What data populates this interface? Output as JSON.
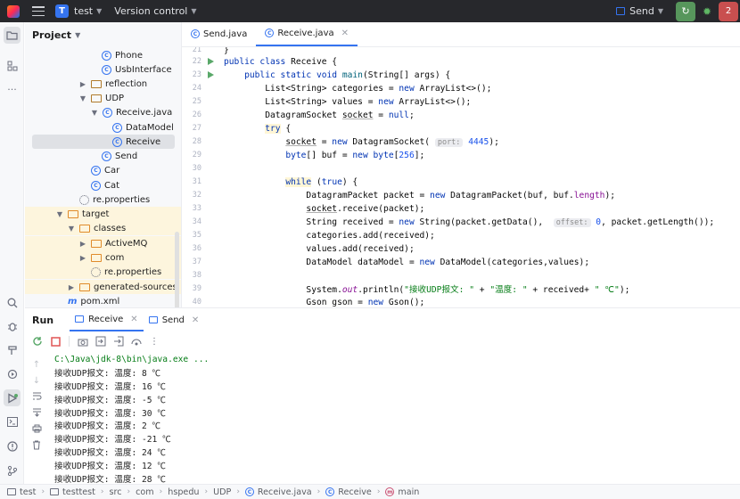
{
  "titlebar": {
    "project_initial": "T",
    "project_name": "test",
    "vcs_label": "Version control",
    "run_config": "Send",
    "notification_count": "2"
  },
  "project_panel": {
    "title": "Project",
    "items": [
      {
        "label": "Phone",
        "kind": "class"
      },
      {
        "label": "UsbInterface",
        "kind": "class"
      },
      {
        "label": "reflection",
        "kind": "package"
      },
      {
        "label": "UDP",
        "kind": "package"
      },
      {
        "label": "Receive.java",
        "kind": "class"
      },
      {
        "label": "DataModel",
        "kind": "class"
      },
      {
        "label": "Receive",
        "kind": "class"
      },
      {
        "label": "Send",
        "kind": "class"
      },
      {
        "label": "Car",
        "kind": "class"
      },
      {
        "label": "Cat",
        "kind": "class"
      },
      {
        "label": "re.properties",
        "kind": "properties"
      },
      {
        "label": "target",
        "kind": "folder"
      },
      {
        "label": "classes",
        "kind": "folder"
      },
      {
        "label": "ActiveMQ",
        "kind": "folder"
      },
      {
        "label": "com",
        "kind": "folder"
      },
      {
        "label": "re.properties",
        "kind": "properties"
      },
      {
        "label": "generated-sources",
        "kind": "folder"
      },
      {
        "label": "pom.xml",
        "kind": "maven"
      }
    ]
  },
  "editor": {
    "tabs": [
      {
        "label": "Send.java",
        "active": false
      },
      {
        "label": "Receive.java",
        "active": true
      }
    ],
    "line_numbers": [
      "21",
      "22",
      "23",
      "24",
      "25",
      "26",
      "27",
      "28",
      "29",
      "30",
      "31",
      "32",
      "33",
      "34",
      "35",
      "36",
      "37",
      "38",
      "39",
      "40"
    ],
    "hints": {
      "port": "port:",
      "offset": "offset:"
    },
    "code": {
      "l22": [
        "public class ",
        "Receive {"
      ],
      "l23": [
        "public static void ",
        "main",
        "(String[] args) {"
      ],
      "l24": [
        "List<String> categories = ",
        "new ",
        "ArrayList<>();"
      ],
      "l25": [
        "List<String> values = ",
        "new ",
        "ArrayList<>();"
      ],
      "l26": [
        "DatagramSocket ",
        "socket",
        " = ",
        "null",
        ";"
      ],
      "l27": [
        "try",
        " {"
      ],
      "l28": [
        "socket",
        " = ",
        "new ",
        "DatagramSocket(",
        "4445",
        ");"
      ],
      "l29": [
        "byte",
        "[] buf = ",
        "new ",
        "byte",
        "[",
        "256",
        "];"
      ],
      "l31": [
        "while",
        " (",
        "true",
        ") {"
      ],
      "l32": [
        "DatagramPacket packet = ",
        "new ",
        "DatagramPacket(buf, buf.",
        "length",
        ");"
      ],
      "l33": [
        "socket",
        ".receive(packet);"
      ],
      "l34": [
        "String received = ",
        "new ",
        "String(packet.getData(), ",
        "0",
        ", packet.getLength());"
      ],
      "l35": [
        "categories.add(received);"
      ],
      "l36": [
        "values.add(received);"
      ],
      "l37": [
        "DataModel dataModel = ",
        "new ",
        "DataModel(categories,values);"
      ],
      "l39": [
        "System.",
        "out",
        ".println(",
        "\"接收UDP报文: \"",
        " + ",
        "\"温度: \"",
        " + received+ ",
        "\" ℃\"",
        ");"
      ],
      "l40": [
        "Gson gson = ",
        "new ",
        "Gson();"
      ]
    }
  },
  "run_panel": {
    "title": "Run",
    "tabs": [
      {
        "label": "Receive",
        "active": true
      },
      {
        "label": "Send",
        "active": false
      }
    ],
    "console_lines": [
      "C:\\Java\\jdk-8\\bin\\java.exe ...",
      "接收UDP报文: 温度: 8 ℃",
      "接收UDP报文: 温度: 16 ℃",
      "接收UDP报文: 温度: -5 ℃",
      "接收UDP报文: 温度: 30 ℃",
      "接收UDP报文: 温度: 2 ℃",
      "接收UDP报文: 温度: -21 ℃",
      "接收UDP报文: 温度: 24 ℃",
      "接收UDP报文: 温度: 12 ℃",
      "接收UDP报文: 温度: 28 ℃"
    ]
  },
  "statusbar": {
    "breadcrumbs": [
      "test",
      "testtest",
      "src",
      "com",
      "hspedu",
      "UDP",
      "Receive.java",
      "Receive",
      "main"
    ]
  }
}
